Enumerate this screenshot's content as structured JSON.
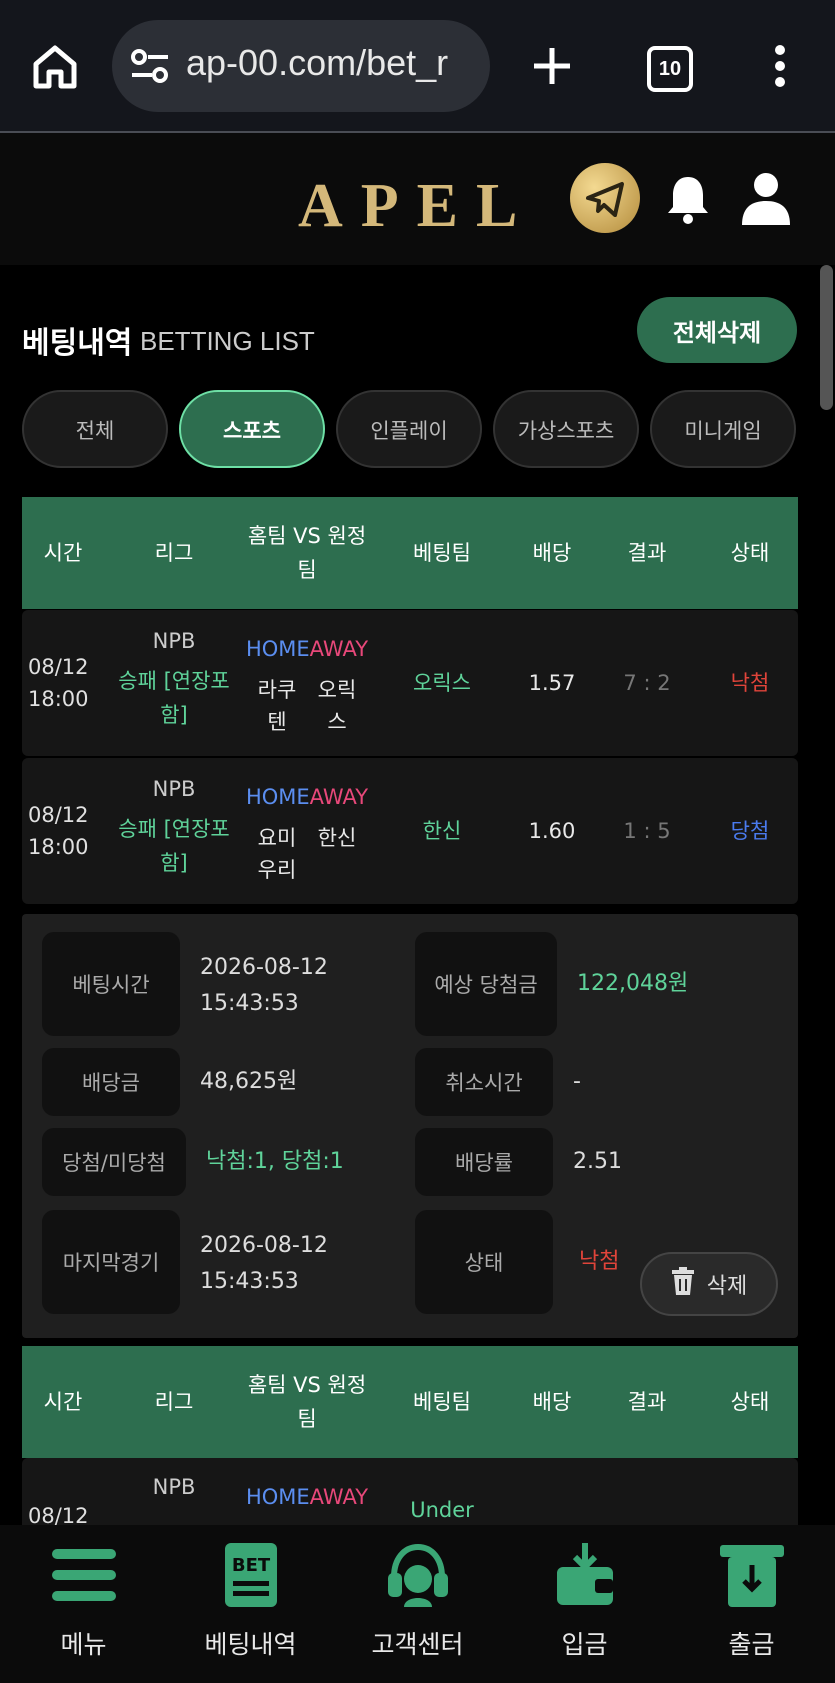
{
  "browser": {
    "url": "ap-00.com/bet_r",
    "tab_count": "10"
  },
  "site": {
    "logo": "APEL"
  },
  "page": {
    "title": "베팅내역",
    "subtitle": "BETTING LIST",
    "delete_all": "전체삭제"
  },
  "tabs": [
    "전체",
    "스포츠",
    "인플레이",
    "가상스포츠",
    "미니게임"
  ],
  "table_headers": [
    "시간",
    "리그",
    "홈팀 VS 원정팀",
    "베팅팀",
    "배당",
    "결과",
    "상태"
  ],
  "bets": [
    {
      "date": "08/12",
      "time": "18:00",
      "league": "NPB",
      "market": "승패 [연장포함]",
      "home_label": "HOME",
      "away_label": "AWAY",
      "home": "라쿠텐",
      "away": "오릭스",
      "bet_team": "오릭스",
      "odds": "1.57",
      "score": "7 : 2",
      "status": "낙첨",
      "status_color": "#e0443a"
    },
    {
      "date": "08/12",
      "time": "18:00",
      "league": "NPB",
      "market": "승패 [연장포함]",
      "home_label": "HOME",
      "away_label": "AWAY",
      "home": "요미우리",
      "away": "한신",
      "bet_team": "한신",
      "odds": "1.60",
      "score": "1 : 5",
      "status": "당첨",
      "status_color": "#4a7bef"
    }
  ],
  "summary": {
    "bet_time_label": "베팅시간",
    "bet_time_date": "2026-08-12",
    "bet_time_time": "15:43:53",
    "expected_label": "예상 당첨금",
    "expected_value": "122,048원",
    "amount_label": "배당금",
    "amount_value": "48,625원",
    "cancel_label": "취소시간",
    "cancel_value": "-",
    "result_label": "당첨/미당첨",
    "result_value": "낙첨:1, 당첨:1",
    "rate_label": "배당률",
    "rate_value": "2.51",
    "last_label": "마지막경기",
    "last_date": "2026-08-12",
    "last_time": "15:43:53",
    "state_label": "상태",
    "state_value": "낙첨",
    "delete_label": "삭제"
  },
  "next_bet": {
    "date": "08/12",
    "league": "NPB",
    "home_label": "HOME",
    "away_label": "AWAY",
    "bet_team": "Under"
  },
  "nav": [
    {
      "label": "메뉴",
      "icon": "menu-icon"
    },
    {
      "label": "베팅내역",
      "icon": "bet-icon"
    },
    {
      "label": "고객센터",
      "icon": "headset-icon"
    },
    {
      "label": "입금",
      "icon": "deposit-wallet-icon"
    },
    {
      "label": "출금",
      "icon": "withdraw-icon"
    }
  ],
  "colors": {
    "accent": "#2d6e4f",
    "win": "#4a7bef",
    "lose": "#e0443a",
    "green_text": "#5fd39a"
  }
}
